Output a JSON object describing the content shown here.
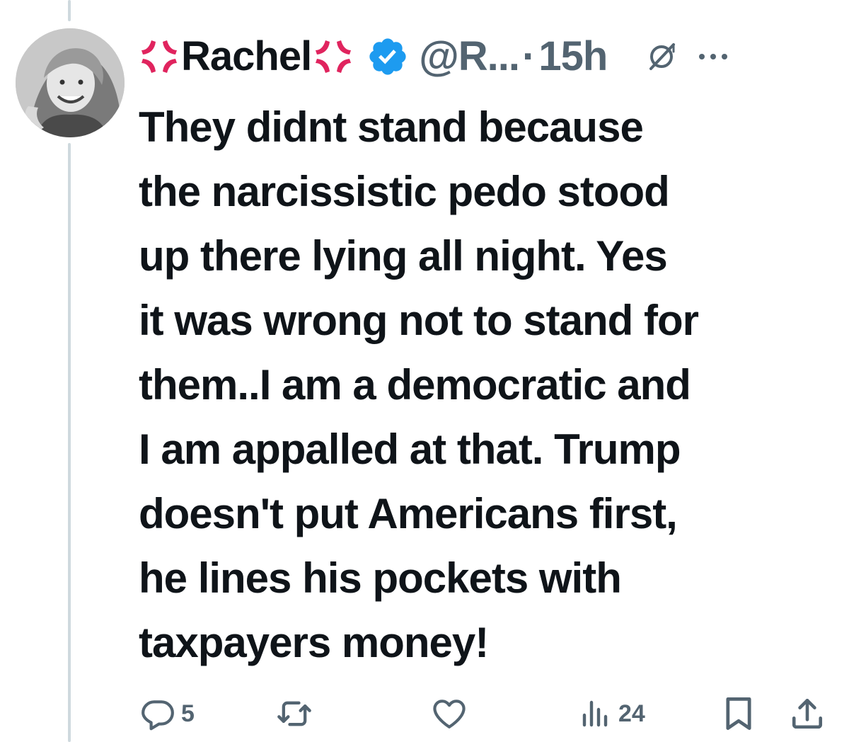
{
  "post": {
    "display_name": "Rachel",
    "name_emoji_left": "anger-symbol",
    "name_emoji_right": "anger-symbol",
    "verified": true,
    "verified_color": "#1d9bf0",
    "handle": "@R...",
    "separator": "·",
    "time": "15h",
    "text": "They didnt stand because\nthe narcissistic pedo stood\nup there lying all night. Yes\nit was wrong not to stand for\nthem..I am a democratic and\nI am appalled at that. Trump\ndoesn't put Americans first,\nhe lines his pockets with\ntaxpayers money!"
  },
  "actions": {
    "reply_count": "5",
    "repost_count": "",
    "like_count": "",
    "views_count": "24"
  },
  "icons": {
    "reply": "reply-icon",
    "repost": "repost-icon",
    "like": "like-icon",
    "views": "views-icon",
    "bookmark": "bookmark-icon",
    "share": "share-icon",
    "grok": "grok-icon",
    "more": "more-icon",
    "verified": "verified-badge-icon",
    "anger": "anger-symbol-icon"
  },
  "colors": {
    "text": "#0f1419",
    "secondary": "#536471",
    "accent": "#1d9bf0",
    "anger_red": "#e0245e",
    "thread_line": "#cfd9de"
  }
}
